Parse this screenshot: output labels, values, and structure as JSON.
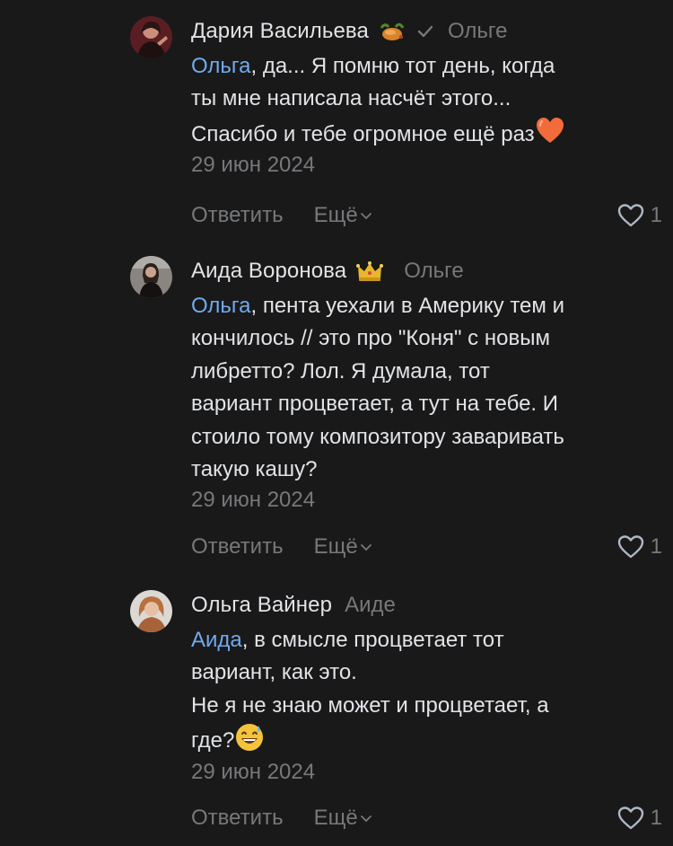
{
  "comments": [
    {
      "author": "Дария Васильева",
      "badge_icon": "turkey-icon",
      "reply_to": "Ольге",
      "mention": "Ольга",
      "text_lines": [
        ", да... Я помню тот день, когда",
        "ты мне написала насчёт этого...",
        "Спасибо и тебе огромное ещё раз"
      ],
      "trailing_emoji": "orange-heart-emoji",
      "date": "29 июн 2024",
      "reply_label": "Ответить",
      "more_label": "Ещё",
      "likes": "1"
    },
    {
      "author": "Аида Воронова",
      "badge_icon": "crown-icon",
      "reply_to": "Ольге",
      "mention": "Ольга",
      "text_lines": [
        ", пента уехали в Америку тем и",
        "кончилось // это про \"Коня\" с новым",
        "либретто? Лол. Я думала, тот",
        "вариант процветает, а тут на тебе. И",
        "стоило тому композитору заваривать",
        "такую кашу?"
      ],
      "date": "29 июн 2024",
      "reply_label": "Ответить",
      "more_label": "Ещё",
      "likes": "1"
    },
    {
      "author": "Ольга Вайнер",
      "reply_to": "Аиде",
      "mention": "Аида",
      "text_lines": [
        ", в смысле процветает тот",
        "вариант, как это.",
        "Не я не знаю может и процветает, а",
        "где?"
      ],
      "trailing_emoji": "grinning-sweat-emoji",
      "date": "29 июн 2024",
      "reply_label": "Ответить",
      "more_label": "Ещё",
      "likes": "1"
    }
  ],
  "colors": {
    "background": "#19191a",
    "text": "#e1e3e6",
    "secondary": "#76787a",
    "mention": "#71aaeb"
  }
}
